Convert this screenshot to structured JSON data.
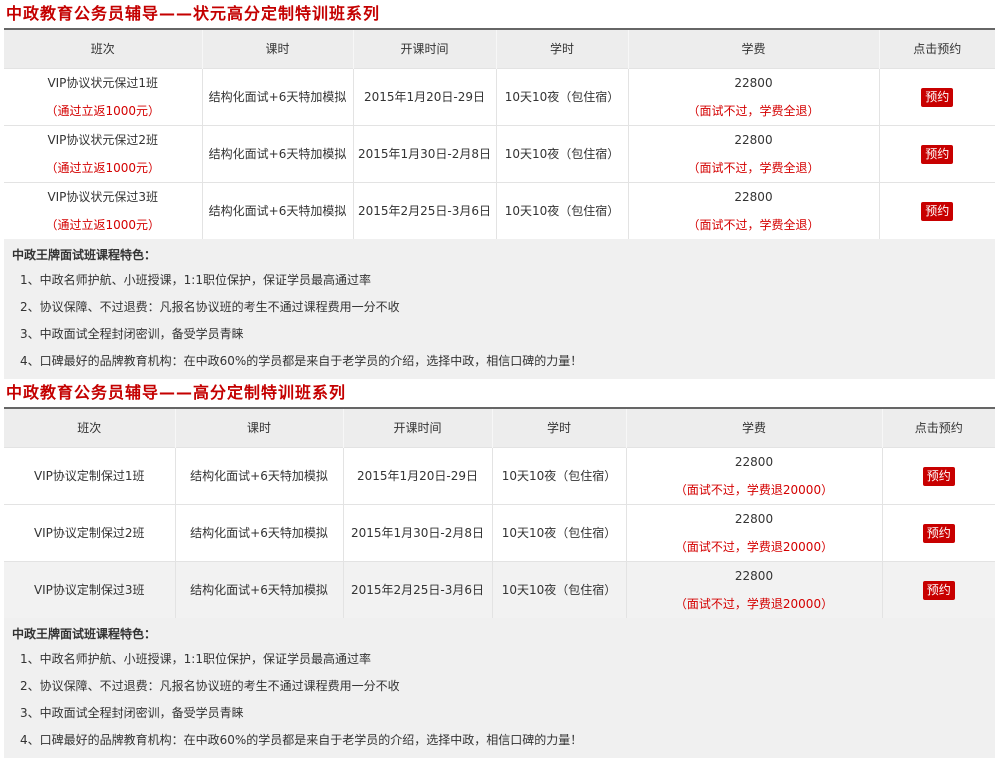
{
  "sections": [
    {
      "title": "中政教育公务员辅导——状元高分定制特训班系列",
      "headers": [
        "班次",
        "课时",
        "开课时间",
        "学时",
        "学费",
        "点击预约"
      ],
      "rows": [
        {
          "name": "VIP协议状元保过1班",
          "name_note": "（通过立返1000元）",
          "course": "结构化面试+6天特加模拟",
          "date": "2015年1月20日-29日",
          "hours": "10天10夜（包住宿）",
          "fee": "22800",
          "fee_note": "（面试不过，学费全退）",
          "button": "预约"
        },
        {
          "name": "VIP协议状元保过2班",
          "name_note": "（通过立返1000元）",
          "course": "结构化面试+6天特加模拟",
          "date": "2015年1月30日-2月8日",
          "hours": "10天10夜（包住宿）",
          "fee": "22800",
          "fee_note": "（面试不过，学费全退）",
          "button": "预约"
        },
        {
          "name": "VIP协议状元保过3班",
          "name_note": "（通过立返1000元）",
          "course": "结构化面试+6天特加模拟",
          "date": "2015年2月25日-3月6日",
          "hours": "10天10夜（包住宿）",
          "fee": "22800",
          "fee_note": "（面试不过，学费全退）",
          "button": "预约"
        }
      ],
      "features_title": "中政王牌面试班课程特色：",
      "features": [
        "1、中政名师护航、小班授课，1:1职位保护，保证学员最高通过率",
        "2、协议保障、不过退费：凡报名协议班的考生不通过课程费用一分不收",
        "3、中政面试全程封闭密训，备受学员青睐",
        "4、口碑最好的品牌教育机构：在中政60%的学员都是来自于老学员的介绍，选择中政，相信口碑的力量！"
      ]
    },
    {
      "title": "中政教育公务员辅导——高分定制特训班系列",
      "headers": [
        "班次",
        "课时",
        "开课时间",
        "学时",
        "学费",
        "点击预约"
      ],
      "rows": [
        {
          "name": "VIP协议定制保过1班",
          "course": "结构化面试+6天特加模拟",
          "date": "2015年1月20日-29日",
          "hours": "10天10夜（包住宿）",
          "fee": "22800",
          "fee_note": "（面试不过，学费退20000）",
          "button": "预约"
        },
        {
          "name": "VIP协议定制保过2班",
          "course": "结构化面试+6天特加模拟",
          "date": "2015年1月30日-2月8日",
          "hours": "10天10夜（包住宿）",
          "fee": "22800",
          "fee_note": "（面试不过，学费退20000）",
          "button": "预约"
        },
        {
          "name": "VIP协议定制保过3班",
          "course": "结构化面试+6天特加模拟",
          "date": "2015年2月25日-3月6日",
          "hours": "10天10夜（包住宿）",
          "fee": "22800",
          "fee_note": "（面试不过，学费退20000）",
          "button": "预约"
        }
      ],
      "features_title": "中政王牌面试班课程特色：",
      "features": [
        "1、中政名师护航、小班授课，1:1职位保护，保证学员最高通过率",
        "2、协议保障、不过退费：凡报名协议班的考生不通过课程费用一分不收",
        "3、中政面试全程封闭密训，备受学员青睐",
        "4、口碑最好的品牌教育机构：在中政60%的学员都是来自于老学员的介绍，选择中政，相信口碑的力量！"
      ]
    }
  ],
  "colors": {
    "accent": "#c40000",
    "button": "#c80000",
    "note": "#d40000",
    "panel": "#f0f0f0"
  }
}
